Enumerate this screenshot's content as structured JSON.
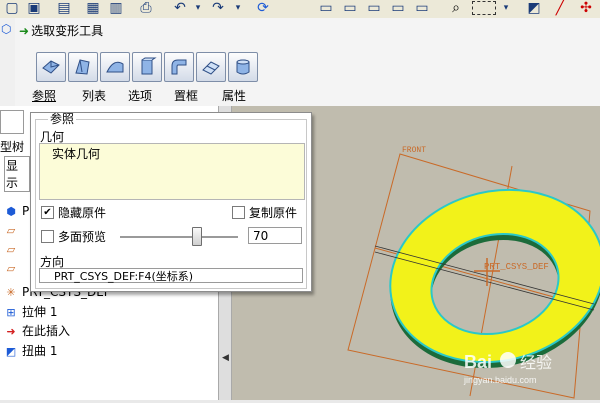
{
  "dashboard": {
    "title": "选取变形工具",
    "tools": [
      {
        "icon": "transform-icon"
      },
      {
        "icon": "warp-icon"
      },
      {
        "icon": "spine-icon"
      },
      {
        "icon": "stretch-icon"
      },
      {
        "icon": "bend-icon"
      },
      {
        "icon": "twist-icon"
      },
      {
        "icon": "sculpt-icon"
      }
    ],
    "tabs": [
      "参照",
      "列表",
      "选项",
      "置框",
      "属性"
    ]
  },
  "side_tabs": [
    "型树",
    "显示"
  ],
  "panel": {
    "group_legend": "参照",
    "geometry_label": "几何",
    "geometry_item": "实体几何",
    "hide_original": {
      "label": "隐藏原件",
      "checked": true
    },
    "copy_original": {
      "label": "复制原件",
      "checked": false
    },
    "multi_preview": {
      "label": "多面预览",
      "checked": false
    },
    "slider_value_text": "70",
    "slider_fraction": 0.7,
    "direction_label": "方向",
    "direction_value": "PRT_CSYS_DEF:F4(坐标系)"
  },
  "tree": {
    "items": [
      {
        "label": "PRT",
        "icon": "part-icon"
      },
      {
        "label": "",
        "icon": "datum-plane-icon"
      },
      {
        "label": "",
        "icon": "datum-plane-icon"
      },
      {
        "label": "",
        "icon": "datum-plane-icon"
      },
      {
        "label": "PRT_CSYS_DEF",
        "icon": "csys-icon"
      },
      {
        "label": "拉伸 1",
        "icon": "extrude-icon"
      },
      {
        "label": "在此插入",
        "icon": "insert-here-icon"
      },
      {
        "label": "扭曲 1",
        "icon": "warp-feature-icon"
      }
    ]
  },
  "graphics": {
    "front_label": "FRONT",
    "csys_label": "PRT_CSYS_DEF",
    "ring_color": "#f2f21a",
    "ring_edge_color": "#2bc8c8",
    "ring_shadow_color": "#1c6b3a",
    "plane_color": "#c96a28",
    "background": "#c0bcae"
  },
  "watermark": {
    "brand": "Bai",
    "name": "经验",
    "url": "jingyan.baidu.com"
  },
  "colors": {
    "accent": "#1b8a1b"
  }
}
